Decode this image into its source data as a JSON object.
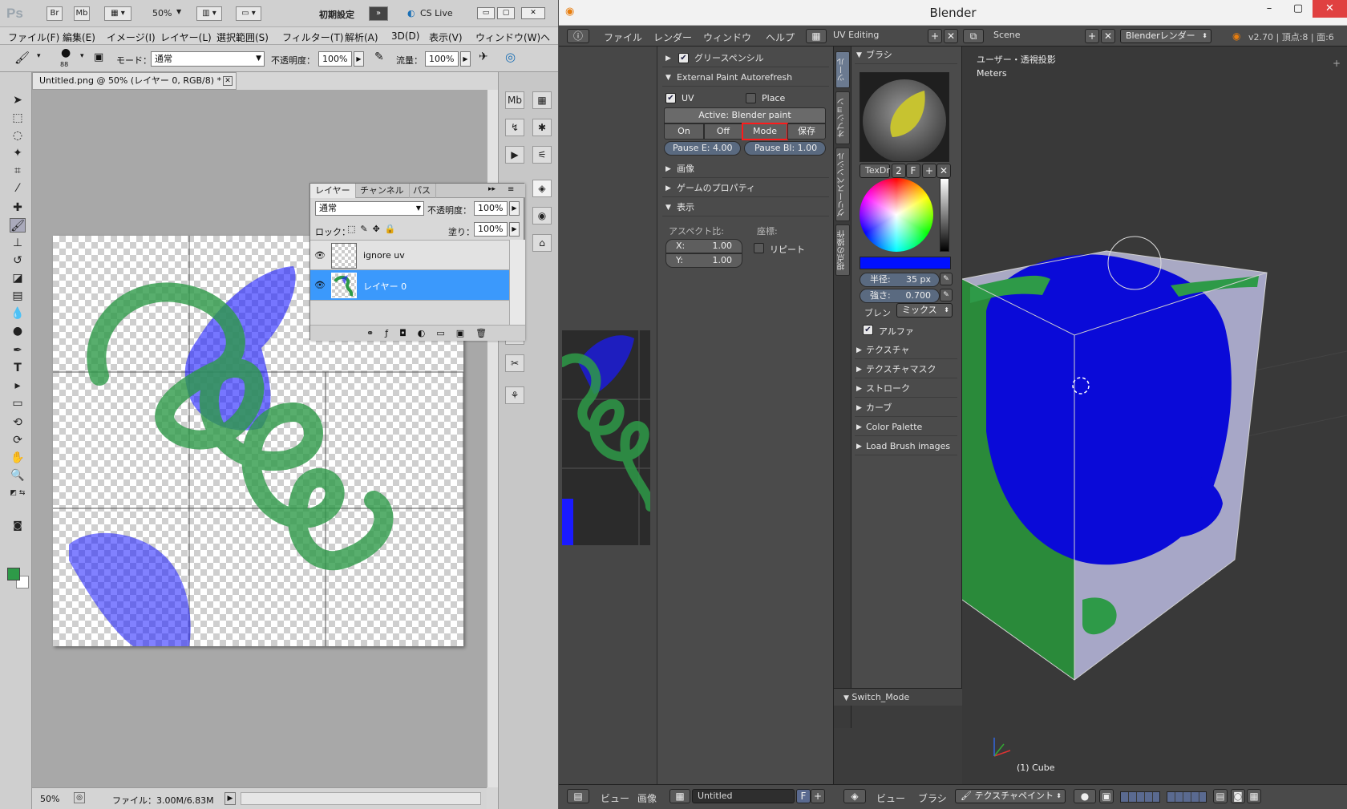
{
  "photoshop": {
    "logo": "Ps",
    "titlebar": {
      "br": "Br",
      "mb": "Mb",
      "zoom": "50%",
      "workspace": "初期設定",
      "cslive": "CS Live"
    },
    "menu": [
      "ファイル(F)",
      "編集(E)",
      "イメージ(I)",
      "レイヤー(L)",
      "選択範囲(S)",
      "フィルター(T)",
      "解析(A)",
      "3D(D)",
      "表示(V)",
      "ウィンドウ(W)",
      "ヘ"
    ],
    "options": {
      "brush_size": "88",
      "mode_label": "モード：",
      "mode_value": "通常",
      "opacity_label": "不透明度：",
      "opacity_value": "100%",
      "flow_label": "流量：",
      "flow_value": "100%"
    },
    "document_tab": "Untitled.png @ 50% (レイヤー 0, RGB/8) *",
    "status": {
      "zoom": "50%",
      "file_info": "ファイル：3.00M/6.83M"
    },
    "layers_panel": {
      "tabs": [
        "レイヤー",
        "チャンネル",
        "パス"
      ],
      "blend_mode": "通常",
      "opacity_label": "不透明度：",
      "opacity_value": "100%",
      "lock_label": "ロック：",
      "fill_label": "塗り：",
      "fill_value": "100%",
      "layers": [
        {
          "name": "ignore uv",
          "selected": false
        },
        {
          "name": "レイヤー 0",
          "selected": true
        }
      ]
    }
  },
  "blender": {
    "title": "Blender",
    "menu": [
      "ファイル",
      "レンダー",
      "ウィンドウ",
      "ヘルプ"
    ],
    "layout": "UV Editing",
    "scene": "Scene",
    "render_engine": "Blenderレンダー",
    "version_info": "v2.70 | 頂点:8 | 面:6",
    "uv_panel": {
      "grease_pencil": "グリースペンシル",
      "external_paint": "External Paint Autorefresh",
      "uv_label": "UV",
      "place_label": "Place",
      "active": "Active: Blender paint",
      "buttons": [
        "On",
        "Off",
        "Mode",
        "保存"
      ],
      "pause_e": "Pause E: 4.00",
      "pause_bl": "Pause Bl: 1.00",
      "image": "画像",
      "game_props": "ゲームのプロパティ",
      "display": "表示",
      "aspect_label": "アスペクト比:",
      "coords_label": "座標:",
      "x_field": "X:",
      "x_value": "1.00",
      "y_field": "Y:",
      "y_value": "1.00",
      "repeat": "リピート"
    },
    "vtabs": [
      "ツール",
      "オプション",
      "グリースペンシル",
      "視点の操作"
    ],
    "brush_panel": {
      "header": "ブラシ",
      "texdr": "TexDr",
      "texdr_count": "2",
      "texdr_f": "F",
      "radius_label": "半径:",
      "radius_value": "35 px",
      "strength_label": "強さ:",
      "strength_value": "0.700",
      "blend_label": "ブレン",
      "blend_value": "ミックス",
      "alpha_label": "アルファ",
      "sections": [
        "テクスチャ",
        "テクスチャマスク",
        "ストローク",
        "カーブ",
        "Color Palette",
        "Load Brush images"
      ],
      "color": "#0010ff"
    },
    "switch_mode": "Switch_Mode",
    "viewport": {
      "view_label": "ユーザー・透視投影",
      "units": "Meters",
      "object_label": "(1) Cube"
    },
    "bottom": {
      "view": "ビュー",
      "image": "画像",
      "image_name": "Untitled",
      "image_f": "F",
      "view3d": "ビュー",
      "brush": "ブラシ",
      "mode": "テクスチャペイント"
    },
    "colors": {
      "paint_green": "#2e9a48",
      "paint_blue": "#1a1aff",
      "selection_blue": "#3b99fc",
      "highlight_red": "#ff1a1a"
    }
  }
}
